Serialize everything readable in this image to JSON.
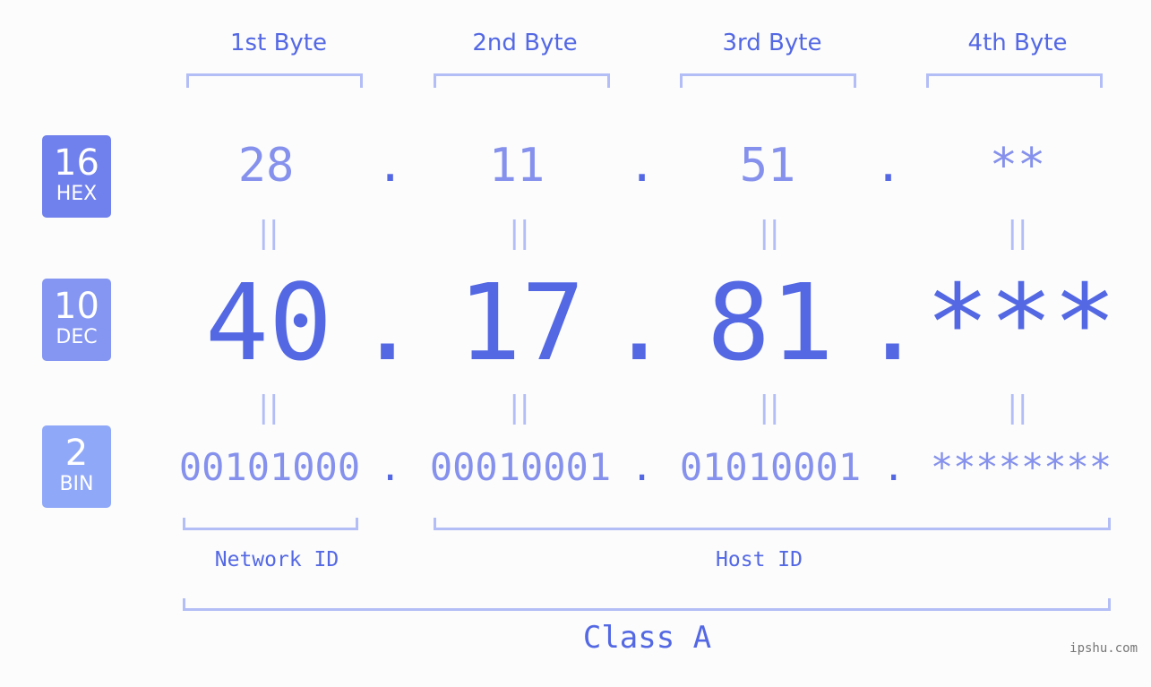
{
  "colors": {
    "accent": "#5468e4",
    "value_light": "#8591ec",
    "bracket": "#b3bdf6",
    "hex_badge": "#7080ec",
    "dec_badge": "#8495f2",
    "bin_badge": "#90a8f8",
    "background": "#fbfcfb"
  },
  "badges": [
    {
      "number": "16",
      "label": "HEX"
    },
    {
      "number": "10",
      "label": "DEC"
    },
    {
      "number": "2",
      "label": "BIN"
    }
  ],
  "byte_headers": [
    "1st Byte",
    "2nd Byte",
    "3rd Byte",
    "4th Byte"
  ],
  "hex_values": [
    "28",
    "11",
    "51",
    "**"
  ],
  "dec_values": [
    "40",
    "17",
    "81",
    "***"
  ],
  "bin_values": [
    "00101000",
    "00010001",
    "01010001",
    "********"
  ],
  "separator": ".",
  "equals_sign": "||",
  "network_id_label": "Network ID",
  "host_id_label": "Host ID",
  "class_label": "Class A",
  "watermark": "ipshu.com"
}
